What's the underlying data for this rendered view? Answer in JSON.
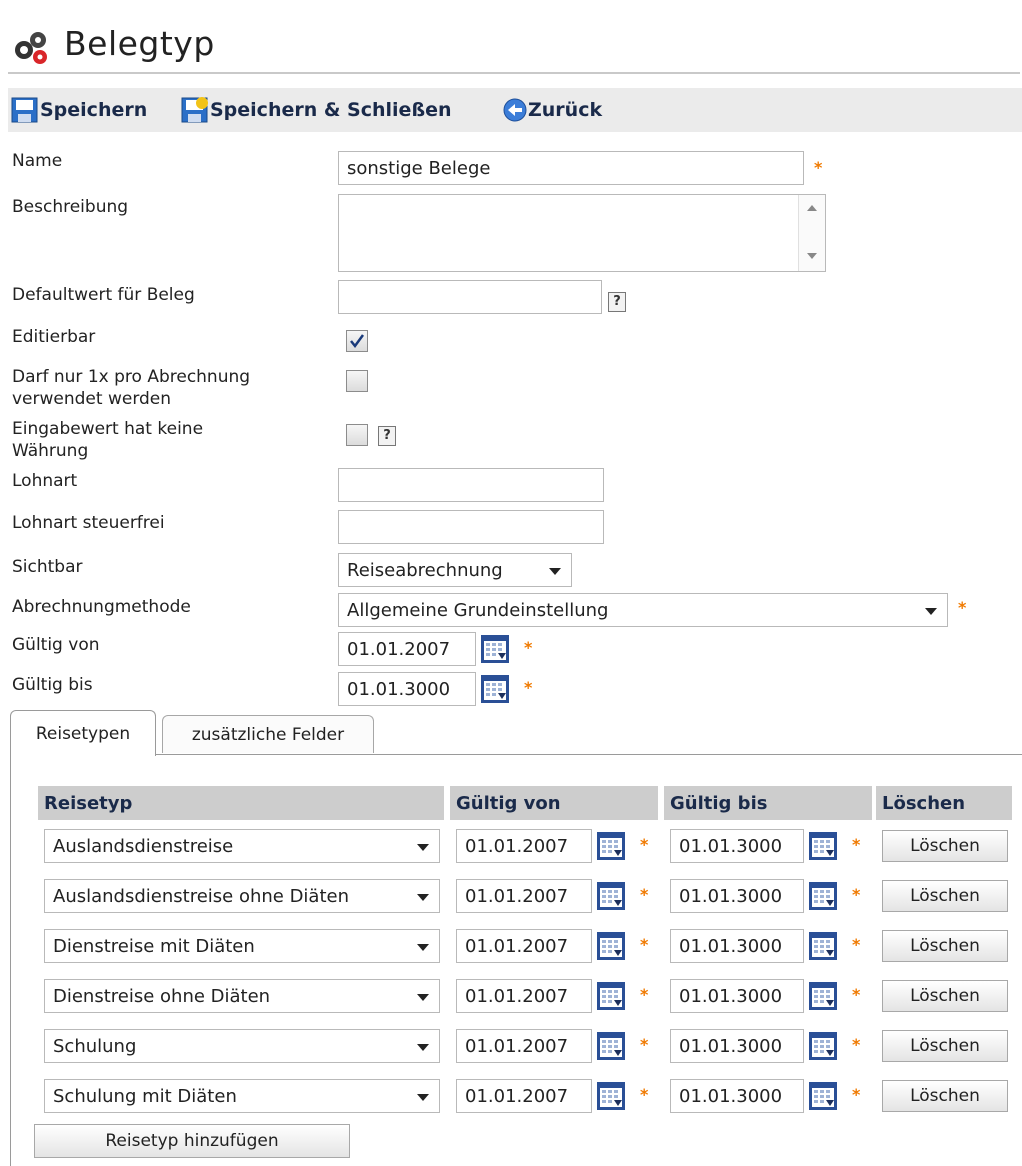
{
  "page": {
    "title": "Belegtyp"
  },
  "toolbar": {
    "save_label": "Speichern",
    "save_close_label": "Speichern & Schließen",
    "back_label": "Zurück"
  },
  "form": {
    "name_label": "Name",
    "name_value": "sonstige Belege",
    "description_label": "Beschreibung",
    "description_value": "",
    "default_label": "Defaultwert für Beleg",
    "default_value": "",
    "editable_label": "Editierbar",
    "editable_checked": true,
    "once_label_1": "Darf nur 1x pro Abrechnung",
    "once_label_2": "verwendet werden",
    "once_checked": false,
    "nocurrency_label_1": "Eingabewert hat keine",
    "nocurrency_label_2": "Währung",
    "nocurrency_checked": false,
    "wage_label": "Lohnart",
    "wage_value": "",
    "wage_taxfree_label": "Lohnart steuerfrei",
    "wage_taxfree_value": "",
    "visible_label": "Sichtbar",
    "visible_value": "Reiseabrechnung",
    "method_label": "Abrechnungmethode",
    "method_value": "Allgemeine Grundeinstellung",
    "valid_from_label": "Gültig von",
    "valid_from_value": "01.01.2007",
    "valid_to_label": "Gültig bis",
    "valid_to_value": "01.01.3000",
    "help_glyph": "?"
  },
  "tabs": [
    {
      "label": "Reisetypen",
      "active": true
    },
    {
      "label": "zusätzliche Felder",
      "active": false
    }
  ],
  "table": {
    "columns": [
      "Reisetyp",
      "Gültig von",
      "Gültig bis",
      "Löschen"
    ],
    "rows": [
      {
        "type": "Auslandsdienstreise",
        "from": "01.01.2007",
        "to": "01.01.3000",
        "delete": "Löschen"
      },
      {
        "type": "Auslandsdienstreise ohne Diäten",
        "from": "01.01.2007",
        "to": "01.01.3000",
        "delete": "Löschen"
      },
      {
        "type": "Dienstreise mit Diäten",
        "from": "01.01.2007",
        "to": "01.01.3000",
        "delete": "Löschen"
      },
      {
        "type": "Dienstreise ohne Diäten",
        "from": "01.01.2007",
        "to": "01.01.3000",
        "delete": "Löschen"
      },
      {
        "type": "Schulung",
        "from": "01.01.2007",
        "to": "01.01.3000",
        "delete": "Löschen"
      },
      {
        "type": "Schulung mit Diäten",
        "from": "01.01.2007",
        "to": "01.01.3000",
        "delete": "Löschen"
      }
    ],
    "add_label": "Reisetyp hinzufügen"
  },
  "colors": {
    "required": "#f07a00",
    "header_bg": "#cdcdcd",
    "toolbar_bg": "#ebebeb",
    "calendar_blue": "#2a4f96"
  },
  "icons": [
    "belegtyp-icon",
    "save-icon",
    "save-close-icon",
    "back-icon",
    "calendar-icon",
    "help-icon",
    "checkmark-icon",
    "chevron-down-icon"
  ]
}
